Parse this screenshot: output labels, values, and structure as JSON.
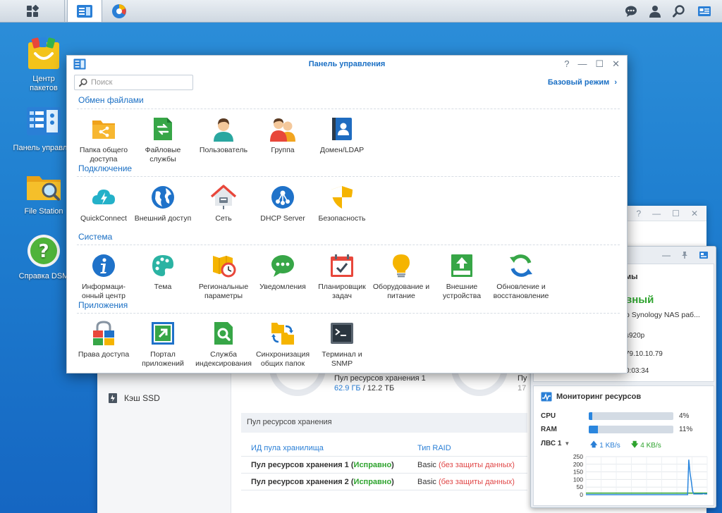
{
  "taskbar": {
    "main_menu_icon": "grid-icon",
    "control_panel_icon": "control-panel-icon",
    "storage_icon": "storage-manager-icon",
    "right_icons": [
      "chat-icon",
      "user-icon",
      "search-icon",
      "widgets-icon"
    ]
  },
  "desktop": {
    "icons": [
      {
        "label": "Центр\nпакетов",
        "icon": "package-center-icon"
      },
      {
        "label": "Панель управле",
        "icon": "control-panel-icon"
      },
      {
        "label": "File Station",
        "icon": "folder-search-icon"
      },
      {
        "label": "Справка DSM",
        "icon": "help-icon"
      }
    ]
  },
  "control_panel": {
    "title": "Панель управления",
    "search_placeholder": "Поиск",
    "basic_mode": "Базовый режим",
    "sections": [
      {
        "title": "Обмен файлами",
        "items": [
          {
            "label": "Папка общего доступа",
            "icon": "shared-folder-icon"
          },
          {
            "label": "Файловые службы",
            "icon": "file-services-icon"
          },
          {
            "label": "Пользователь",
            "icon": "user-icon"
          },
          {
            "label": "Группа",
            "icon": "group-icon"
          },
          {
            "label": "Домен/LDAP",
            "icon": "domain-ldap-icon"
          }
        ]
      },
      {
        "title": "Подключение",
        "items": [
          {
            "label": "QuickConnect",
            "icon": "quickconnect-icon"
          },
          {
            "label": "Внешний доступ",
            "icon": "globe-icon"
          },
          {
            "label": "Сеть",
            "icon": "network-house-icon"
          },
          {
            "label": "DHCP Server",
            "icon": "dhcp-server-icon"
          },
          {
            "label": "Безопасность",
            "icon": "shield-icon"
          }
        ]
      },
      {
        "title": "Система",
        "items": [
          {
            "label": "Информаци-онный центр",
            "icon": "info-icon"
          },
          {
            "label": "Тема",
            "icon": "palette-icon"
          },
          {
            "label": "Региональные параметры",
            "icon": "regional-clock-icon"
          },
          {
            "label": "Уведомления",
            "icon": "notification-bubble-icon"
          },
          {
            "label": "Планировщик задач",
            "icon": "calendar-check-icon"
          },
          {
            "label": "Оборудование и питание",
            "icon": "lightbulb-icon"
          },
          {
            "label": "Внешние устройства",
            "icon": "external-device-icon"
          },
          {
            "label": "Обновление и восстановление",
            "icon": "update-restore-icon"
          }
        ]
      },
      {
        "title": "Приложения",
        "items": [
          {
            "label": "Права доступа",
            "icon": "lock-icon"
          },
          {
            "label": "Портал приложений",
            "icon": "app-portal-icon"
          },
          {
            "label": "Служба индексирования",
            "icon": "indexing-search-icon"
          },
          {
            "label": "Синхронизация общих папок",
            "icon": "folder-sync-icon"
          },
          {
            "label": "Терминал и SNMP",
            "icon": "terminal-icon"
          }
        ]
      }
    ]
  },
  "storage_window": {
    "ssd_cache": "Кэш SSD",
    "volume_label": "Пул ресурсов хранения 1",
    "volume_value": "62.9 ГБ",
    "volume_total": "/ 12.2 ТБ",
    "volume2_label_partial": "Пу",
    "volume2_value_partial": "17",
    "pool_section": "Пул ресурсов хранения",
    "pool_table": {
      "headers": [
        "ИД пула хранилища",
        "Тип RAID"
      ],
      "rows": [
        {
          "name": "Пул ресурсов хранения 1",
          "status": "Исправно",
          "raid": "Basic",
          "raid_note": "(без защиты данных)"
        },
        {
          "name": "Пул ресурсов хранения 2",
          "status": "Исправно",
          "raid": "Basic",
          "raid_note": "(без защиты данных)"
        }
      ]
    }
  },
  "system_health": {
    "partial_title": "мы",
    "status_partial": "вный",
    "description_partial": "о Synology NAS раб...",
    "model_partial": "s920p",
    "ip_partial": "79.10.10.79",
    "uptime_partial": "0:03:34"
  },
  "resource_monitor": {
    "title": "Мониторинг ресурсов",
    "cpu_label": "CPU",
    "cpu_percent": 4,
    "cpu_text": "4%",
    "ram_label": "RAM",
    "ram_percent": 11,
    "ram_text": "11%",
    "lan_label": "ЛВС 1",
    "upload": "1 KB/s",
    "download": "4 KB/s",
    "chart_y_ticks": [
      "250",
      "200",
      "150",
      "100",
      "50",
      "0"
    ],
    "chart_series_up": [
      0,
      0,
      0,
      0,
      0,
      0,
      0,
      0,
      0,
      0,
      0,
      0,
      0,
      0,
      0,
      0,
      0,
      0,
      0,
      0,
      0,
      0,
      0,
      0,
      0,
      0,
      0,
      0,
      0,
      0,
      0,
      0,
      0,
      0,
      0,
      0,
      0,
      0,
      0,
      0,
      0,
      0,
      0,
      0,
      0,
      0,
      0,
      0,
      0,
      0,
      0,
      0,
      0,
      0,
      0,
      0,
      0,
      0,
      0,
      0,
      0,
      0,
      0,
      0,
      0,
      0,
      0,
      0,
      0,
      0,
      0,
      0,
      0,
      0,
      0,
      0,
      0,
      0,
      0,
      0,
      0,
      0,
      0,
      0,
      230,
      140,
      90,
      25,
      5,
      5,
      5,
      5,
      5,
      5,
      5,
      5,
      8,
      5,
      5,
      5
    ],
    "chart_series_down": [
      10,
      10,
      10,
      10,
      10,
      10,
      10,
      10,
      10,
      10,
      10,
      10,
      10,
      10,
      10,
      10,
      10,
      10,
      10,
      10,
      10,
      10,
      10,
      10,
      10,
      10,
      10,
      10,
      10,
      10,
      10,
      10,
      10,
      10,
      10,
      10,
      10,
      10,
      10,
      10,
      10,
      10,
      10,
      10,
      10,
      10,
      10,
      10,
      10,
      10,
      10,
      10,
      10,
      10,
      10,
      10,
      10,
      10,
      10,
      10,
      10,
      10,
      10,
      10,
      10,
      10,
      10,
      10,
      10,
      10,
      10,
      10,
      10,
      10,
      10,
      10,
      10,
      10,
      10,
      10,
      10,
      10,
      10,
      10,
      10,
      10,
      10,
      10,
      10,
      10,
      10,
      10,
      10,
      10,
      10,
      10,
      10,
      10,
      10,
      10
    ]
  },
  "colors": {
    "accent": "#1a6fc4",
    "ok": "#2ea32e",
    "warn": "#e04848"
  }
}
